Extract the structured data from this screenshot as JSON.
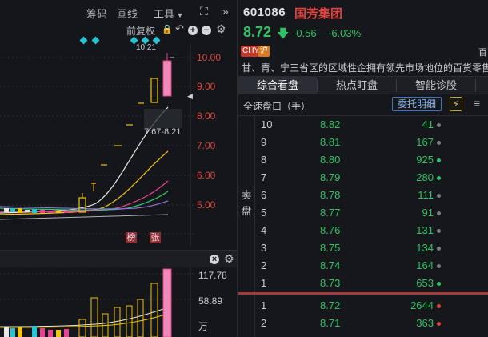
{
  "toolbar": {
    "chip_label": "筹码",
    "draw_label": "画线",
    "tools_label": "工具",
    "restore_label": "前复权"
  },
  "kline": {
    "high_label": "10.21",
    "range_label": "7.67-8.21",
    "tag_bang": "榜",
    "tag_zhang": "张",
    "axis": [
      "10.00",
      "9.00",
      "8.00",
      "7.00",
      "6.00",
      "5.00"
    ]
  },
  "volume": {
    "axis": [
      "117.78",
      "58.89",
      "万"
    ]
  },
  "stock": {
    "code": "601086",
    "name": "国芳集团",
    "price": "8.72",
    "change": "-0.56",
    "change_pct": "-6.03%",
    "badge_chy": "CHY",
    "badge_hu": "沪",
    "badge_right": "百",
    "description": "甘、青、宁三省区的区域性企拥有领先市场地位的百货零售"
  },
  "tabs": [
    {
      "label": "综合看盘",
      "active": true
    },
    {
      "label": "热点盯盘",
      "active": false
    },
    {
      "label": "智能诊股",
      "active": false
    }
  ],
  "orderbook": {
    "section_label": "全速盘口（手）",
    "detail_button": "委托明细",
    "sell_label": "卖盘",
    "sells": [
      {
        "level": "10",
        "price": "8.82",
        "qty": "41",
        "dot": "#7a7d84"
      },
      {
        "level": "9",
        "price": "8.81",
        "qty": "167",
        "dot": "#7a7d84"
      },
      {
        "level": "8",
        "price": "8.80",
        "qty": "925",
        "dot": "#2fc265"
      },
      {
        "level": "7",
        "price": "8.79",
        "qty": "280",
        "dot": "#2fc265"
      },
      {
        "level": "6",
        "price": "8.78",
        "qty": "111",
        "dot": "#7a7d84"
      },
      {
        "level": "5",
        "price": "8.77",
        "qty": "91",
        "dot": "#7a7d84"
      },
      {
        "level": "4",
        "price": "8.76",
        "qty": "131",
        "dot": "#7a7d84"
      },
      {
        "level": "3",
        "price": "8.75",
        "qty": "134",
        "dot": "#7a7d84"
      },
      {
        "level": "2",
        "price": "8.74",
        "qty": "164",
        "dot": "#7a7d84"
      },
      {
        "level": "1",
        "price": "8.73",
        "qty": "653",
        "dot": "#2fc265"
      }
    ],
    "buys": [
      {
        "level": "1",
        "price": "8.72",
        "qty": "2644",
        "dot": "#e0443e"
      },
      {
        "level": "2",
        "price": "8.71",
        "qty": "363",
        "dot": "#e0443e"
      }
    ]
  },
  "colors": {
    "up": "#e0443e",
    "down": "#2fc265",
    "accent": "#27c4d6"
  }
}
